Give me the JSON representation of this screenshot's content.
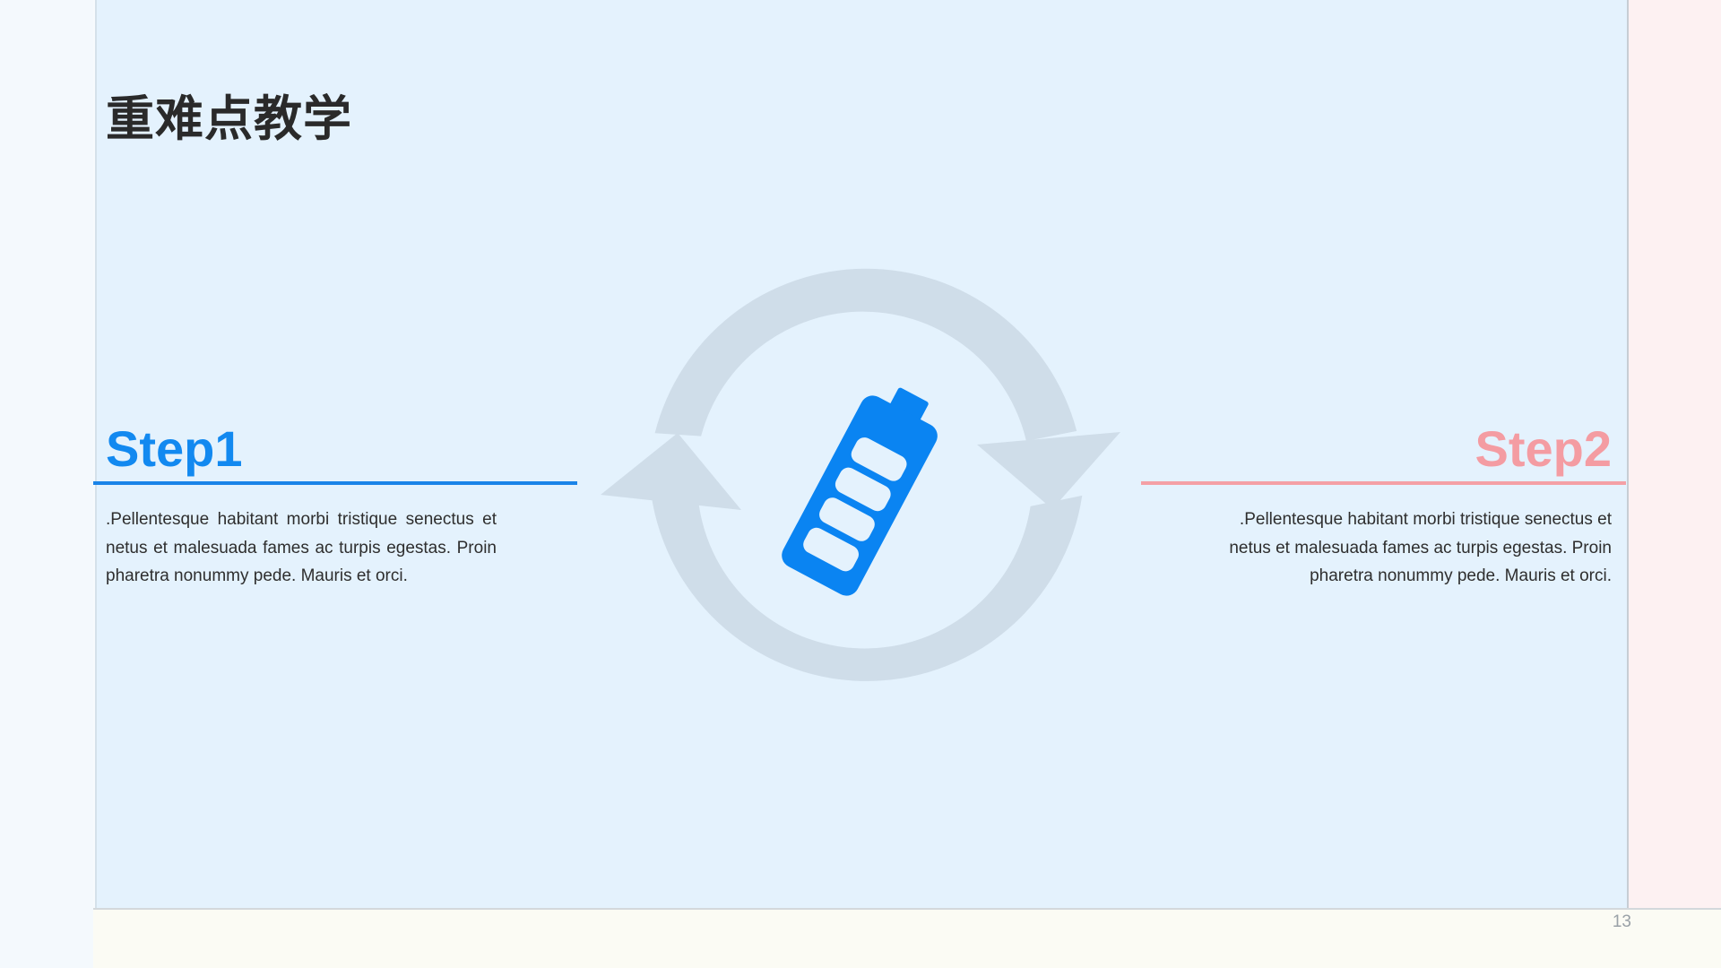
{
  "slide": {
    "title": "重难点教学",
    "page_number": "13"
  },
  "steps": [
    {
      "label": "Step1",
      "text": ".Pellentesque habitant morbi tristique senectus et netus et malesuada fames ac turpis egestas. Proin pharetra nonummy pede. Mauris et orci.",
      "color": "#1289f0"
    },
    {
      "label": "Step2",
      "text": ".Pellentesque habitant morbi tristique senectus et netus et malesuada fames ac turpis egestas. Proin pharetra nonummy pede. Mauris et orci.",
      "color": "#f49ca2"
    }
  ],
  "center_graphic": {
    "icons": [
      "refresh-cycle-icon",
      "battery-charging-icon"
    ],
    "cycle_color": "#cfdde9",
    "battery_color": "#0a84f2",
    "battery_level": 1.0
  }
}
